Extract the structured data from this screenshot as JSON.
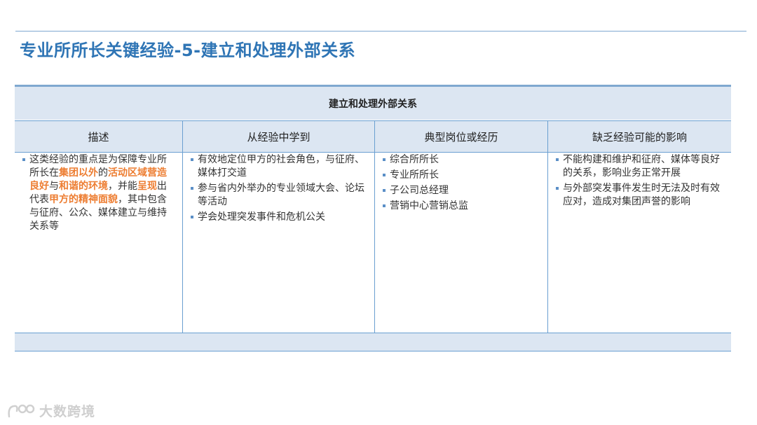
{
  "title": "专业所所长关键经验-5-建立和处理外部关系",
  "table": {
    "header": "建立和处理外部关系",
    "columns": [
      "描述",
      "从经验中学到",
      "典型岗位或经历",
      "缺乏经验可能的影响"
    ],
    "description": {
      "parts": [
        {
          "text": "这类经验的重点是为保障专业所所长在",
          "highlight": false
        },
        {
          "text": "集团以外",
          "highlight": true
        },
        {
          "text": "的",
          "highlight": false
        },
        {
          "text": "活动区域营造良好",
          "highlight": true
        },
        {
          "text": "与",
          "highlight": false
        },
        {
          "text": "和谐的环境",
          "highlight": true
        },
        {
          "text": "，并能",
          "highlight": false
        },
        {
          "text": "呈现",
          "highlight": true
        },
        {
          "text": "出代表",
          "highlight": false
        },
        {
          "text": "甲方的精神面貌",
          "highlight": true
        },
        {
          "text": "，其中包含与征府、公众、媒体建立与维持关系等",
          "highlight": false
        }
      ],
      "highlight_color": "#ed7d31"
    },
    "learned": [
      "有效地定位甲方的社会角色，与征府、媒体打交道",
      "参与省内外举办的专业领域大会、论坛等活动",
      "学会处理突发事件和危机公关"
    ],
    "positions": [
      "综合所所长",
      "专业所所长",
      "子公司总经理",
      "营销中心营销总监"
    ],
    "impact": [
      "不能构建和维护和征府、媒体等良好的关系，影响业务正常开展",
      "与外部突发事件发生时无法及时有效应对，造成对集团声誉的影响"
    ]
  },
  "watermark": {
    "text": "大数跨境",
    "icon": "kawaii-logo-icon"
  },
  "colors": {
    "title": "#2f75b5",
    "band": "#dce6f2",
    "rule": "#6a9fd1",
    "accent": "#ed7d31"
  }
}
